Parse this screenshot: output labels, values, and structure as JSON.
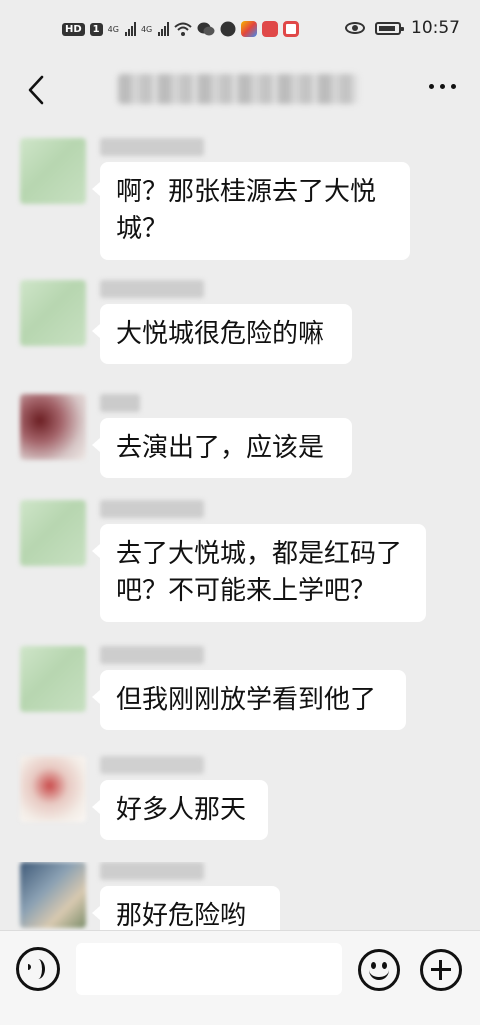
{
  "status_bar": {
    "hd_badge": "HD",
    "sim1_badge": "1",
    "net1": "4G",
    "net2": "4G",
    "time": "10:57"
  },
  "nav": {
    "back_icon": "chevron-left-icon",
    "title": "",
    "more_icon": "more-horizontal-icon"
  },
  "messages": [
    {
      "sender": "",
      "text_line1": "啊？那张桂源去了大悦",
      "text_line2": "城？"
    },
    {
      "sender": "",
      "text": "大悦城很危险的嘛"
    },
    {
      "sender": "",
      "text": "去演出了，应该是"
    },
    {
      "sender": "",
      "text_line1": "去了大悦城，都是红码了",
      "text_line2": "吧？不可能来上学吧？"
    },
    {
      "sender": "",
      "text": "但我刚刚放学看到他了"
    },
    {
      "sender": "",
      "text": "好多人那天"
    },
    {
      "sender": "",
      "text": "那好危险哟"
    }
  ],
  "input_bar": {
    "voice_icon": "voice-icon",
    "input_value": "",
    "emoji_icon": "smiley-icon",
    "add_icon": "plus-icon"
  }
}
